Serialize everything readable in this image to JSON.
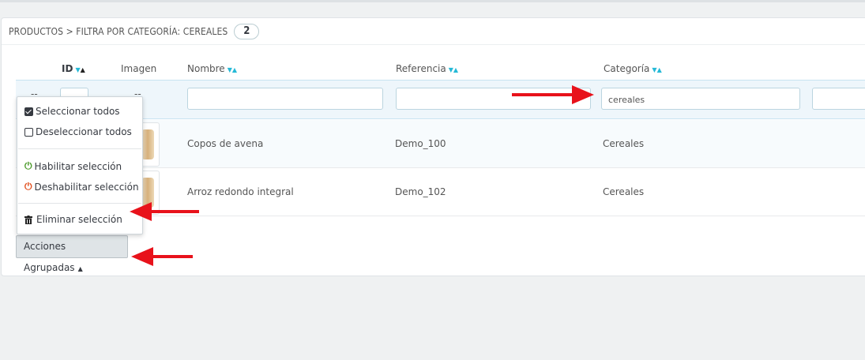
{
  "panel": {
    "title": "PRODUCTOS > FILTRA POR CATEGORÍA: CEREALES",
    "count": "2"
  },
  "columns": {
    "id": "ID",
    "image": "Imagen",
    "name": "Nombre",
    "reference": "Referencia",
    "category": "Categoría"
  },
  "sort_icons": {
    "down": "▼",
    "up": "▲"
  },
  "filters": {
    "select_dash": "--",
    "image_dash": "--",
    "category_value": "cereales"
  },
  "rows": [
    {
      "name": "Copos de avena",
      "reference": "Demo_100",
      "category": "Cereales"
    },
    {
      "name": "Arroz redondo integral",
      "reference": "Demo_102",
      "category": "Cereales"
    }
  ],
  "bulk_menu": {
    "select_all": "Seleccionar todos",
    "deselect_all": "Deseleccionar todos",
    "enable": "Habilitar selección",
    "disable": "Deshabilitar selección",
    "delete": "Eliminar selección"
  },
  "bulk_button": {
    "label": "Acciones Agrupadas",
    "caret": "▲"
  },
  "icons": {
    "power": "⏻",
    "trash": "🗑"
  },
  "colors": {
    "accent": "#25b9d7",
    "arrow": "#e8121b",
    "enable": "#4c9a2a",
    "disable": "#e1501f"
  }
}
